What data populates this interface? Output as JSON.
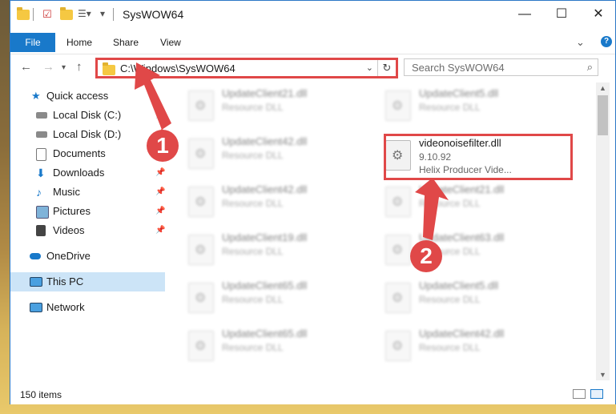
{
  "window": {
    "title": "SysWOW64"
  },
  "ribbon": {
    "tabs": [
      "File",
      "Home",
      "Share",
      "View"
    ]
  },
  "address": {
    "path": "C:\\Windows\\SysWOW64"
  },
  "search": {
    "placeholder": "Search SysWOW64"
  },
  "sidebar": {
    "items": [
      {
        "label": "Quick access"
      },
      {
        "label": "Local Disk (C:)"
      },
      {
        "label": "Local Disk (D:)"
      },
      {
        "label": "Documents"
      },
      {
        "label": "Downloads"
      },
      {
        "label": "Music"
      },
      {
        "label": "Pictures"
      },
      {
        "label": "Videos"
      },
      {
        "label": "OneDrive"
      },
      {
        "label": "This PC"
      },
      {
        "label": "Network"
      }
    ]
  },
  "files": {
    "left": [
      {
        "name": "UpdateClient21.dll",
        "desc": "Resource DLL"
      },
      {
        "name": "UpdateClient42.dll",
        "desc": "Resource DLL"
      },
      {
        "name": "UpdateClient42.dll",
        "desc": "Resource DLL"
      },
      {
        "name": "UpdateClient19.dll",
        "desc": "Resource DLL"
      },
      {
        "name": "UpdateClient65.dll",
        "desc": "Resource DLL"
      },
      {
        "name": "UpdateClient65.dll",
        "desc": "Resource DLL"
      }
    ],
    "right": [
      {
        "name": "UpdateClient5.dll",
        "desc": "Resource DLL"
      },
      {
        "name": "UpdateClient21.dll",
        "desc": "Resource DLL"
      },
      {
        "name": "UpdateClient63.dll",
        "desc": "Resource DLL"
      },
      {
        "name": "UpdateClient5.dll",
        "desc": "Resource DLL"
      },
      {
        "name": "UpdateClient42.dll",
        "desc": "Resource DLL"
      }
    ],
    "featured": {
      "name": "videonoisefilter.dll",
      "version": "9.10.92",
      "desc": "Helix Producer Vide..."
    }
  },
  "status": {
    "items": "150 items"
  },
  "annotations": {
    "step1": "1",
    "step2": "2"
  },
  "colors": {
    "accent": "#1979ca",
    "highlight": "#e04848",
    "selected": "#cce4f7"
  }
}
